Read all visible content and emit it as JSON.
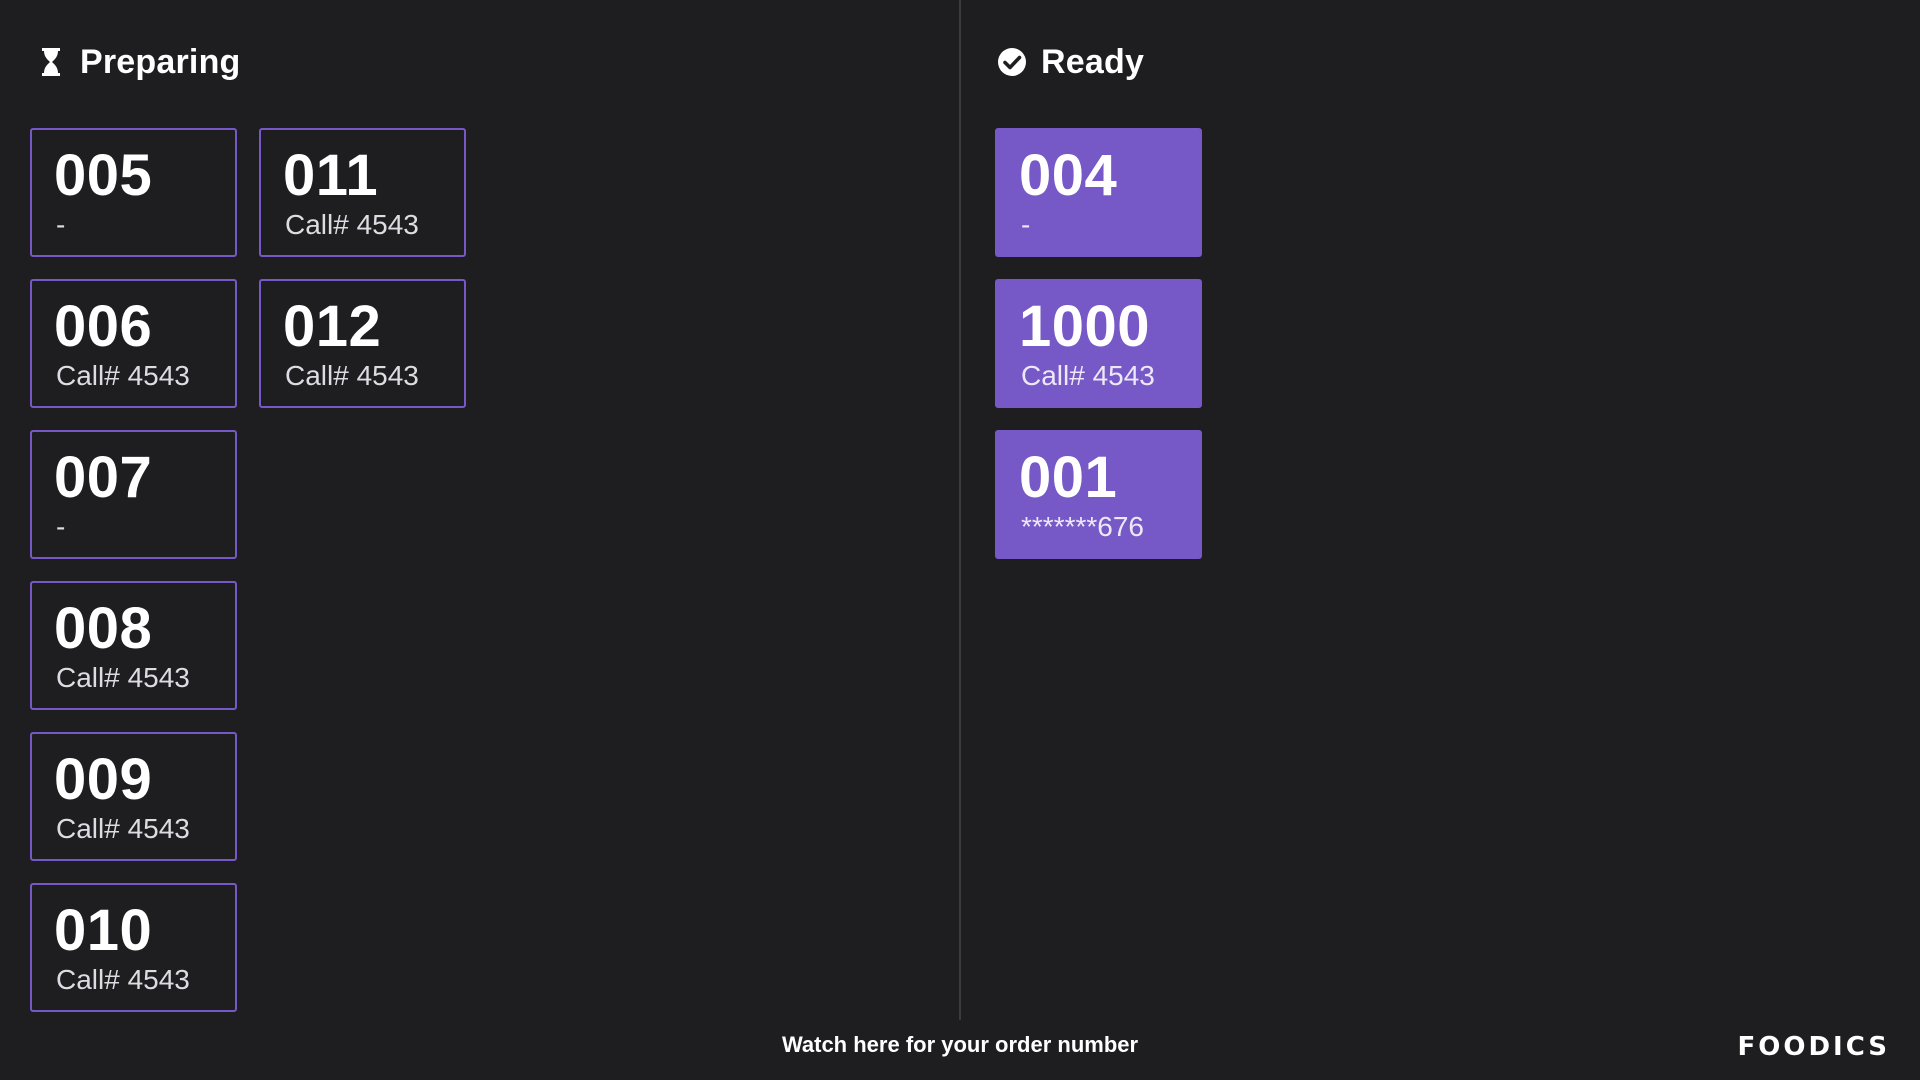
{
  "preparing": {
    "title": "Preparing",
    "icon": "hourglass-icon",
    "columns": [
      [
        {
          "number": "005",
          "sub": "-"
        },
        {
          "number": "006",
          "sub": "Call# 4543"
        },
        {
          "number": "007",
          "sub": "-"
        },
        {
          "number": "008",
          "sub": "Call# 4543"
        },
        {
          "number": "009",
          "sub": "Call# 4543"
        },
        {
          "number": "010",
          "sub": "Call# 4543"
        }
      ],
      [
        {
          "number": "011",
          "sub": "Call# 4543"
        },
        {
          "number": "012",
          "sub": "Call# 4543"
        }
      ]
    ]
  },
  "ready": {
    "title": "Ready",
    "icon": "check-circle-icon",
    "columns": [
      [
        {
          "number": "004",
          "sub": "-"
        },
        {
          "number": "1000",
          "sub": "Call# 4543"
        },
        {
          "number": "001",
          "sub": "*******676"
        }
      ]
    ]
  },
  "footer": {
    "message": "Watch here for your order number",
    "brand": "FOODICS"
  },
  "colors": {
    "background": "#1e1e21",
    "accent": "#7658c6",
    "divider": "#3a3a3f"
  }
}
